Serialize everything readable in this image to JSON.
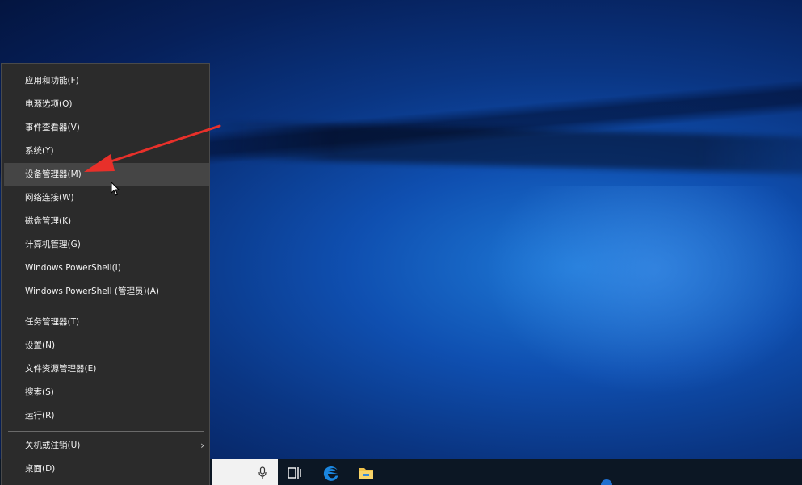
{
  "context_menu": {
    "groups": [
      [
        {
          "label": "应用和功能(F)"
        },
        {
          "label": "电源选项(O)"
        },
        {
          "label": "事件查看器(V)"
        },
        {
          "label": "系统(Y)"
        },
        {
          "label": "设备管理器(M)",
          "highlighted": true
        },
        {
          "label": "网络连接(W)"
        },
        {
          "label": "磁盘管理(K)"
        },
        {
          "label": "计算机管理(G)"
        },
        {
          "label": "Windows PowerShell(I)"
        },
        {
          "label": "Windows PowerShell (管理员)(A)"
        }
      ],
      [
        {
          "label": "任务管理器(T)"
        },
        {
          "label": "设置(N)"
        },
        {
          "label": "文件资源管理器(E)"
        },
        {
          "label": "搜索(S)"
        },
        {
          "label": "运行(R)"
        }
      ],
      [
        {
          "label": "关机或注销(U)",
          "submenu": true
        },
        {
          "label": "桌面(D)"
        }
      ]
    ]
  },
  "annotation": {
    "arrow_color": "#e8302a"
  },
  "taskbar": {
    "icons": [
      "microphone-icon",
      "task-view-icon",
      "edge-icon",
      "file-explorer-icon"
    ]
  },
  "colors": {
    "menu_bg": "#2b2b2b",
    "menu_hover": "#454545",
    "taskbar": "#0c1724"
  }
}
